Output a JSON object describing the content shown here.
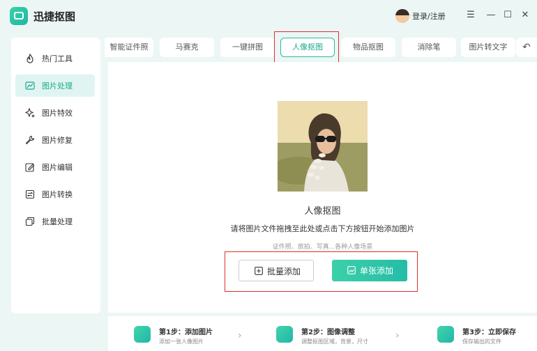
{
  "app": {
    "title": "迅捷抠图",
    "login": "登录/注册"
  },
  "window": {
    "menu": "☰",
    "minimize": "—",
    "maximize": "☐",
    "close": "✕"
  },
  "sidebar": {
    "items": [
      {
        "label": "热门工具",
        "icon": "flame-icon"
      },
      {
        "label": "图片处理",
        "icon": "image-edit-icon"
      },
      {
        "label": "图片特效",
        "icon": "sparkle-icon"
      },
      {
        "label": "图片修复",
        "icon": "wrench-icon"
      },
      {
        "label": "图片编辑",
        "icon": "pencil-icon"
      },
      {
        "label": "图片转换",
        "icon": "convert-icon"
      },
      {
        "label": "批量处理",
        "icon": "stack-icon"
      }
    ],
    "active_index": 1
  },
  "tabs": {
    "items": [
      "智能证件照",
      "马赛克",
      "一键拼图",
      "人像抠图",
      "物品抠图",
      "消除笔",
      "图片转文字"
    ],
    "active_index": 3,
    "redo": "↶"
  },
  "main": {
    "title": "人像抠图",
    "description": "请将图片文件拖拽至此处或点击下方按钮开始添加图片",
    "hint": "证件照、旅拍、写真...各种人像场景",
    "batch_add": "批量添加",
    "single_add": "单张添加"
  },
  "steps": [
    {
      "title": "第1步：添加图片",
      "desc": "添加一张人像图片"
    },
    {
      "title": "第2步：图像调整",
      "desc": "调整抠图区域，背景，尺寸"
    },
    {
      "title": "第3步：立即保存",
      "desc": "保存输出的文件"
    }
  ],
  "colors": {
    "accent": "#2bb9a3",
    "highlight": "#d8312b"
  }
}
